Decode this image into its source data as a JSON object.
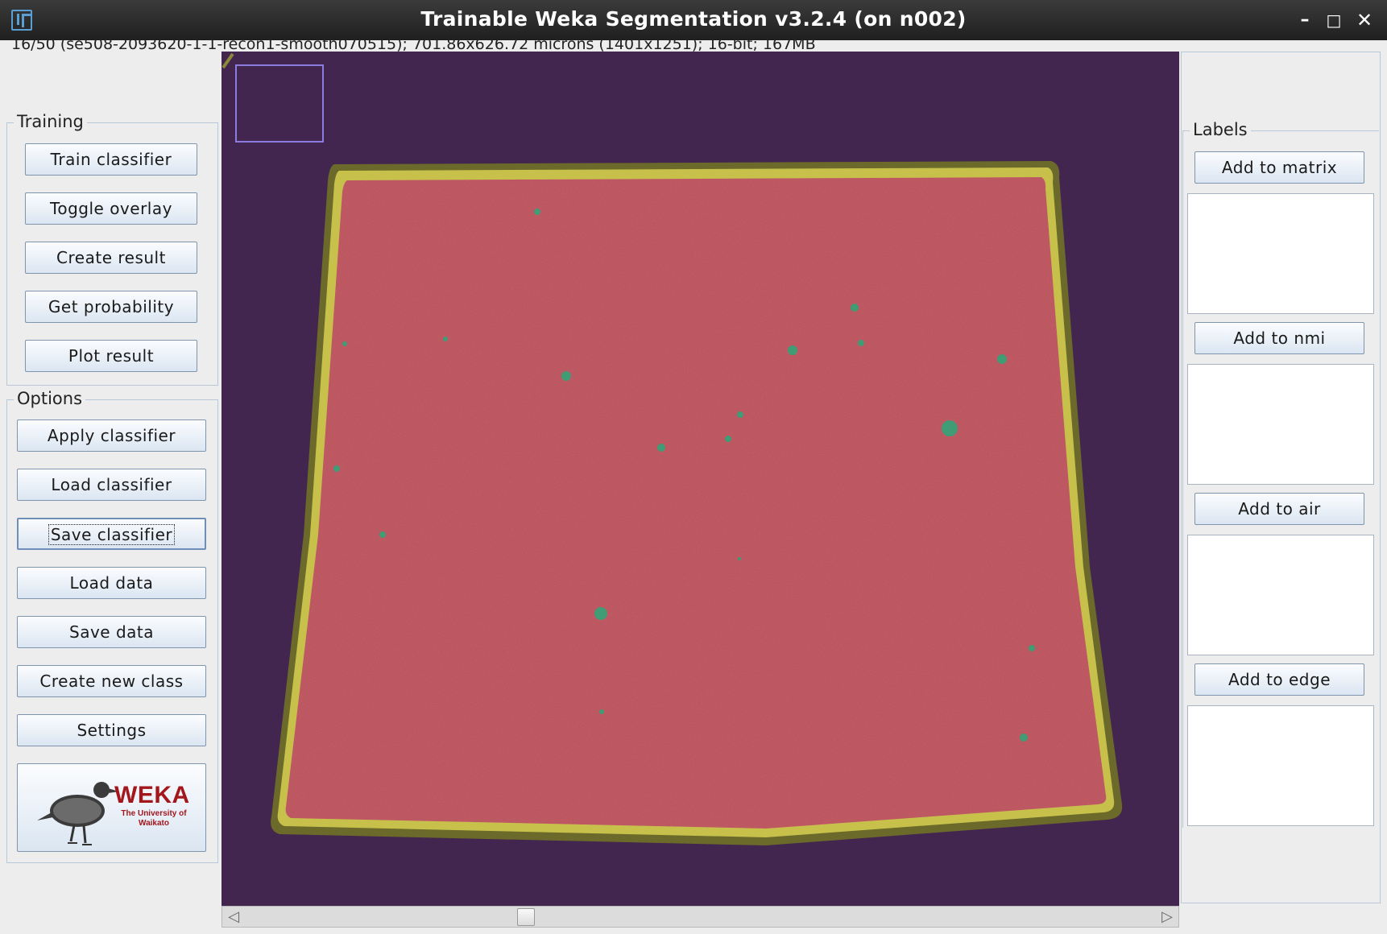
{
  "window": {
    "title": "Trainable Weka Segmentation v3.2.4 (on n002)",
    "info": "16/50 (se508-2093620-1-1-recon1-smooth070515); 701.86x626.72 microns (1401x1251); 16-bit; 167MB"
  },
  "training": {
    "title": "Training",
    "buttons": [
      "Train classifier",
      "Toggle overlay",
      "Create result",
      "Get probability",
      "Plot result"
    ]
  },
  "options": {
    "title": "Options",
    "buttons": [
      "Apply classifier",
      "Load classifier",
      "Save classifier",
      "Load data",
      "Save data",
      "Create new class",
      "Settings"
    ]
  },
  "logo": {
    "word": "WEKA",
    "subtitle": "The University of Waikato"
  },
  "labels": {
    "title": "Labels",
    "buttons": [
      "Add to matrix",
      "Add to nmi",
      "Add to air",
      "Add to edge"
    ]
  },
  "colors": {
    "background": "#43264f",
    "matrix": "#c55c66",
    "edge": "#b9b13a",
    "nmi": "#3f9c74",
    "selection": "#8c7ce0"
  }
}
